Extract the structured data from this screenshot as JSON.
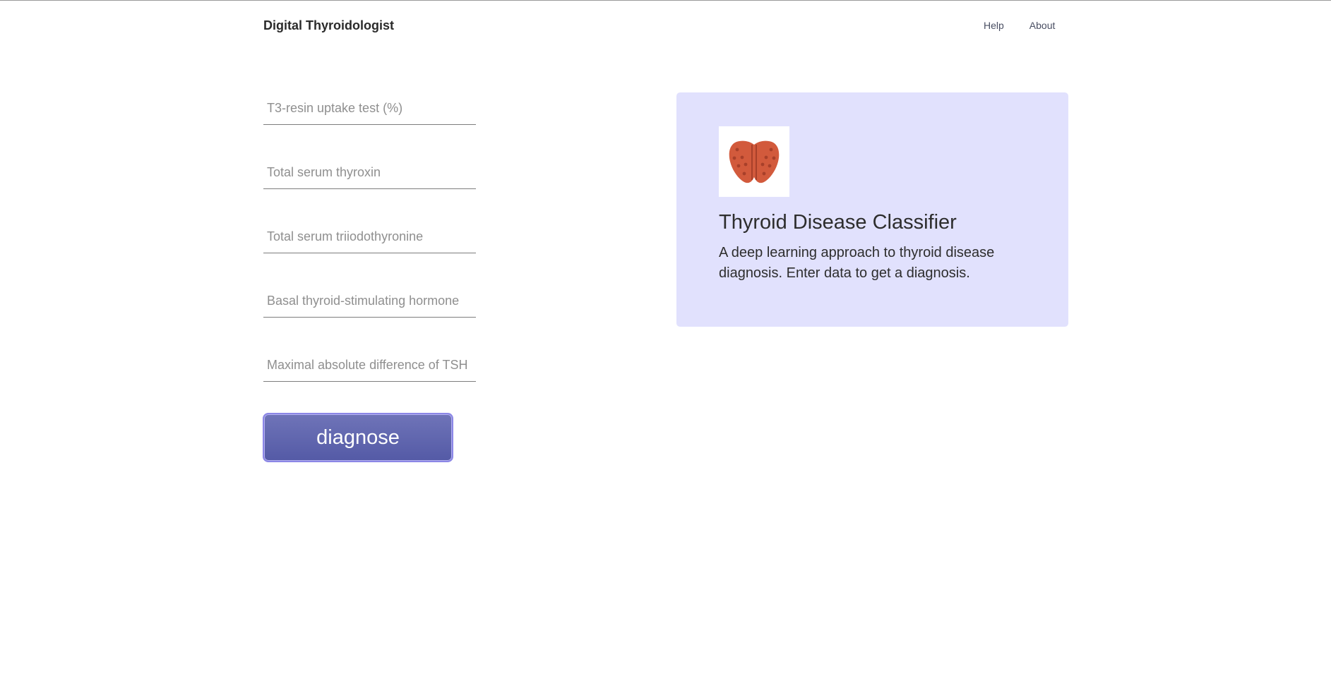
{
  "navbar": {
    "brand": "Digital Thyroidologist",
    "links": [
      "Help",
      "About"
    ]
  },
  "form": {
    "fields": [
      {
        "placeholder": "T3-resin uptake test (%)",
        "value": ""
      },
      {
        "placeholder": "Total serum thyroxin",
        "value": ""
      },
      {
        "placeholder": "Total serum triiodothyronine",
        "value": ""
      },
      {
        "placeholder": "Basal thyroid-stimulating hormone",
        "value": ""
      },
      {
        "placeholder": "Maximal absolute difference of TSH",
        "value": ""
      }
    ],
    "submit_label": "diagnose"
  },
  "card": {
    "logo": "thyroid-gland-icon",
    "title": "Thyroid Disease Classifier",
    "description": "A deep learning approach to thyroid disease diagnosis. Enter data to get a diagnosis."
  },
  "colors": {
    "card_background": "#e1e1fd",
    "button_gradient_top": "#6f74b8",
    "button_gradient_bottom": "#545aa6",
    "button_border": "#8b86e6",
    "thyroid_fill": "#d25a3c"
  }
}
